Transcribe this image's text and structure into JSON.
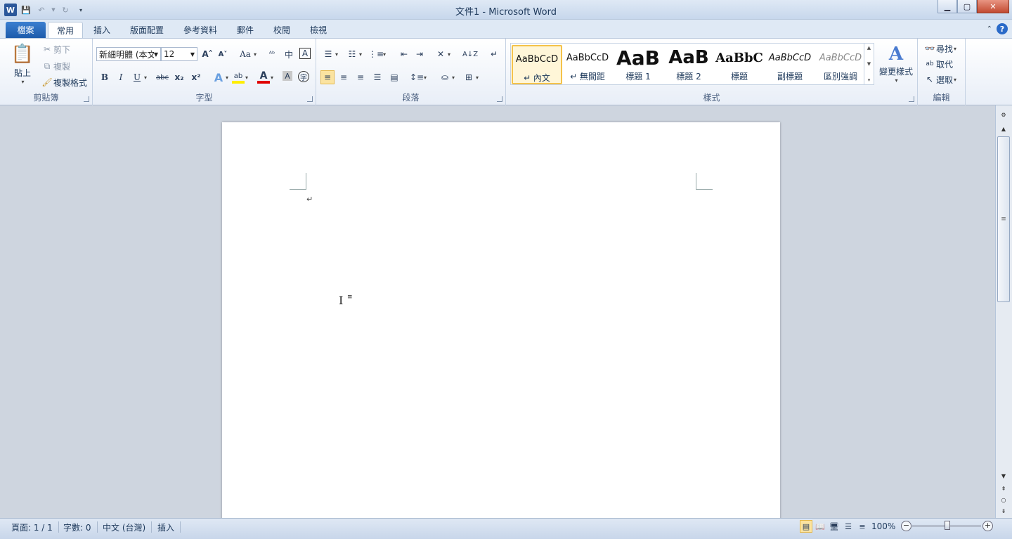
{
  "window": {
    "title": "文件1 - Microsoft Word"
  },
  "qat": {
    "logo": "W"
  },
  "tabs": [
    {
      "label": "檔案"
    },
    {
      "label": "常用"
    },
    {
      "label": "插入"
    },
    {
      "label": "版面配置"
    },
    {
      "label": "參考資料"
    },
    {
      "label": "郵件"
    },
    {
      "label": "校閱"
    },
    {
      "label": "檢視"
    }
  ],
  "clipboard": {
    "paste": "貼上",
    "cut": "剪下",
    "copy": "複製",
    "format_painter": "複製格式",
    "label": "剪貼簿"
  },
  "font": {
    "name": "新細明體 (本文",
    "size": "12",
    "label": "字型"
  },
  "paragraph": {
    "label": "段落"
  },
  "styles": {
    "label": "樣式",
    "change_styles": "變更樣式",
    "items": [
      {
        "sample": "AaBbCcD",
        "name": "↵ 內文"
      },
      {
        "sample": "AaBbCcD",
        "name": "↵ 無間距"
      },
      {
        "sample": "AaB",
        "name": "標題 1"
      },
      {
        "sample": "AaB",
        "name": "標題 2"
      },
      {
        "sample": "AaBbC",
        "name": "標題"
      },
      {
        "sample": "AaBbCcD",
        "name": "副標題"
      },
      {
        "sample": "AaBbCcD",
        "name": "區別強調"
      }
    ]
  },
  "editing": {
    "find": "尋找",
    "replace": "取代",
    "select": "選取",
    "label": "編輯"
  },
  "document": {
    "para_mark": "↵"
  },
  "status": {
    "page": "頁面: 1 / 1",
    "words": "字數: 0",
    "language": "中文 (台灣)",
    "mode": "插入",
    "zoom": "100%"
  }
}
